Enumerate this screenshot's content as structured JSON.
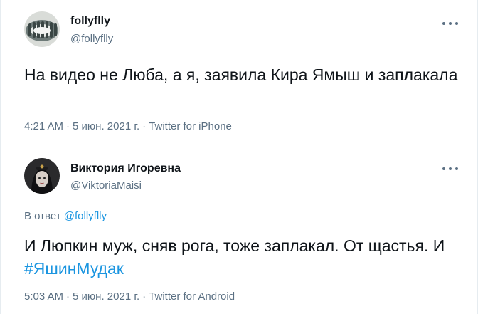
{
  "tweets": [
    {
      "display_name": "follyflly",
      "handle": "@follyflly",
      "text": "На видео не Люба, а я, заявила Кира Ямыш и заплакала",
      "time": "4:21 AM",
      "date": "5 июн. 2021 г.",
      "separator": "·",
      "source": "Twitter for iPhone",
      "more_icon": "more-horizontal-icon"
    },
    {
      "display_name": "Виктория Игоревна",
      "handle": "@ViktoriaMaisi",
      "replying_prefix": "В ответ",
      "replying_to": "@follyflly",
      "text": "И Люпкин муж, сняв рога, тоже заплакал. От щастья. И ",
      "hashtag": "#ЯшинМудак",
      "time": "5:03 AM",
      "date": "5 июн. 2021 г.",
      "separator": "·",
      "source": "Twitter for Android",
      "more_icon": "more-horizontal-icon"
    }
  ],
  "colors": {
    "text": "#0f1419",
    "secondary": "#5b7083",
    "link": "#1b95e0",
    "border": "#e6ecf0"
  }
}
